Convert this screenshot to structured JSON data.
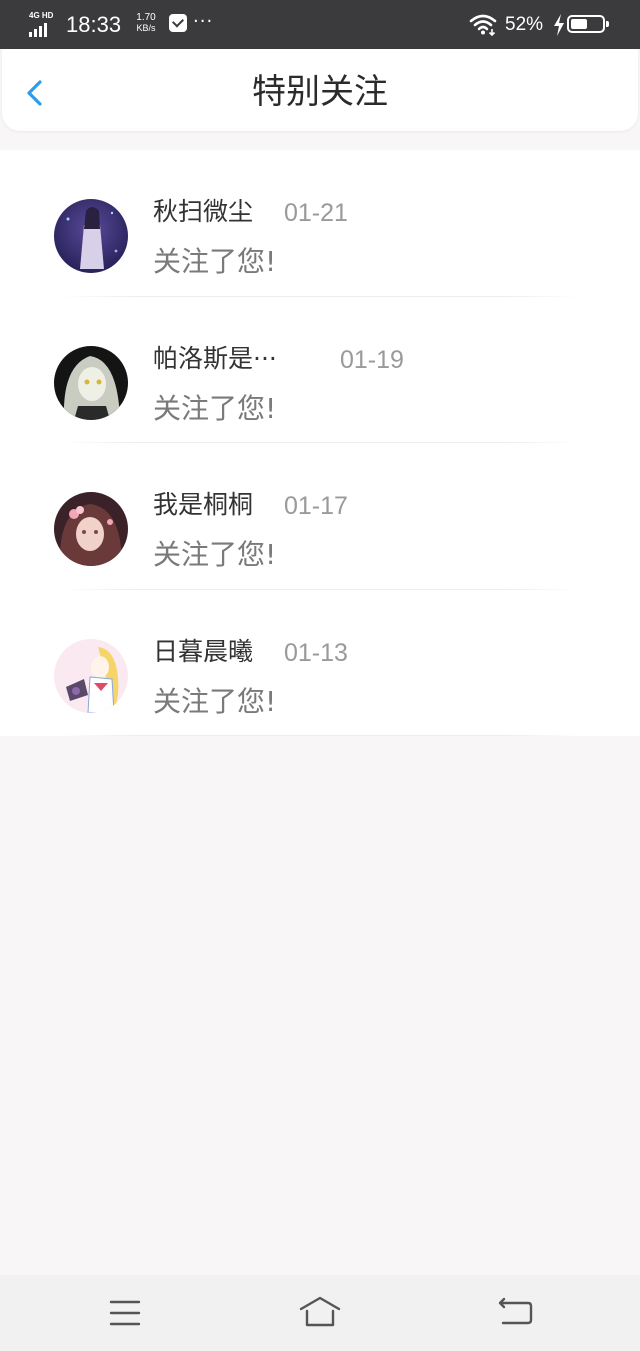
{
  "status_bar": {
    "network": "4G HD",
    "time": "18:33",
    "speed_value": "1.70",
    "speed_unit": "KB/s",
    "more": "···",
    "battery_percent": "52%",
    "battery_level": 0.52
  },
  "header": {
    "title": "特别关注"
  },
  "list": [
    {
      "name": "秋扫微尘",
      "date": "01-21",
      "message": "关注了您!",
      "avatar_colors": [
        "#1e1b4e",
        "#5a4a9a"
      ]
    },
    {
      "name": "帕洛斯是···",
      "date": "01-19",
      "message": "关注了您!",
      "avatar_colors": [
        "#1a1a1a",
        "#c9ccc0"
      ]
    },
    {
      "name": "我是桐桐",
      "date": "01-17",
      "message": "关注了您!",
      "avatar_colors": [
        "#4a2a30",
        "#e9c4c0"
      ]
    },
    {
      "name": "日暮晨曦",
      "date": "01-13",
      "message": "关注了您!",
      "avatar_colors": [
        "#fbe9f1",
        "#f5d56a"
      ]
    }
  ],
  "colors": {
    "status_bar_bg": "#3b3b3d",
    "accent": "#2a9ee8",
    "page_bg": "#f8f6f7"
  },
  "nav": {
    "menu_icon": "menu-icon",
    "home_icon": "home-icon",
    "back_icon": "return-icon"
  }
}
